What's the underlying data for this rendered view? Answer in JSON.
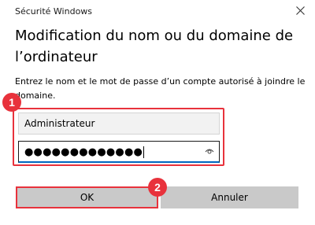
{
  "window": {
    "title": "Sécurité Windows",
    "close_icon": "close-icon"
  },
  "dialog": {
    "heading": "Modification du nom ou du domaine de l’ordinateur",
    "description": "Entrez le nom et le mot de passe d’un compte autorisé à joindre le domaine."
  },
  "fields": {
    "username_value": "Administrateur",
    "password_masked": "●●●●●●●●●●●●●",
    "reveal_icon": "eye-icon"
  },
  "buttons": {
    "ok_label": "OK",
    "cancel_label": "Annuler"
  },
  "annotations": {
    "step1": "1",
    "step2": "2",
    "highlight_color": "#e8323c"
  },
  "colors": {
    "focus_underline": "#0067c0",
    "button_bg": "#c9c9c9"
  }
}
